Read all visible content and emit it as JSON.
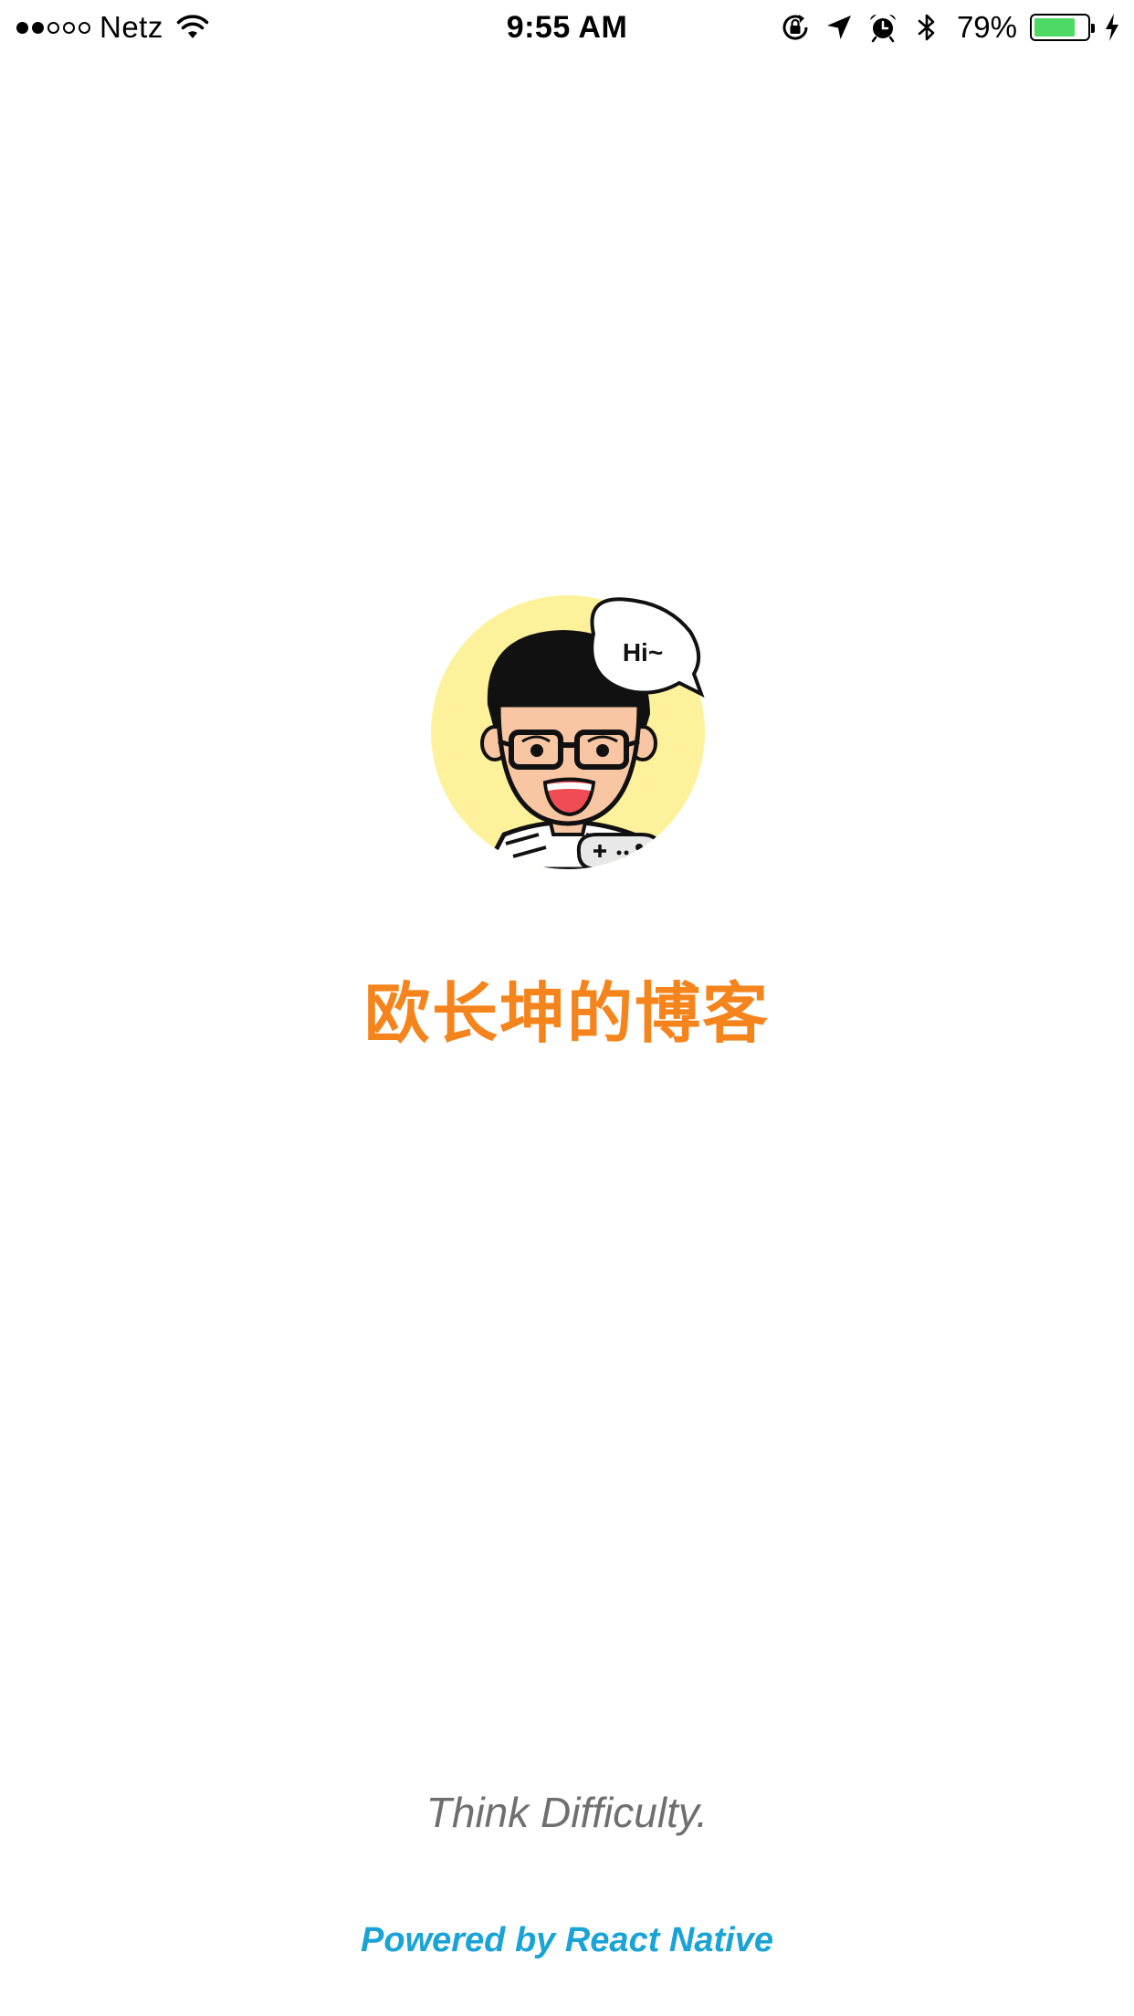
{
  "status_bar": {
    "signal_bars_filled": 2,
    "signal_bars_total": 5,
    "carrier": "Netz",
    "time": "9:55 AM",
    "battery_percent": "79%",
    "battery_level": 0.79,
    "icons": [
      "wifi-icon",
      "orientation-lock-icon",
      "location-arrow-icon",
      "alarm-icon",
      "bluetooth-icon",
      "battery-icon",
      "charging-icon"
    ],
    "battery_color": "#4cd964"
  },
  "splash": {
    "avatar_speech": "Hi~",
    "title": "欧长坤的博客",
    "slogan": "Think Difficulty.",
    "powered_by": "Powered by React Native"
  },
  "colors": {
    "title": "#f4841b",
    "slogan": "#6f6f6f",
    "powered_by": "#1aa3d6",
    "avatar_background": "#fdf29b"
  }
}
